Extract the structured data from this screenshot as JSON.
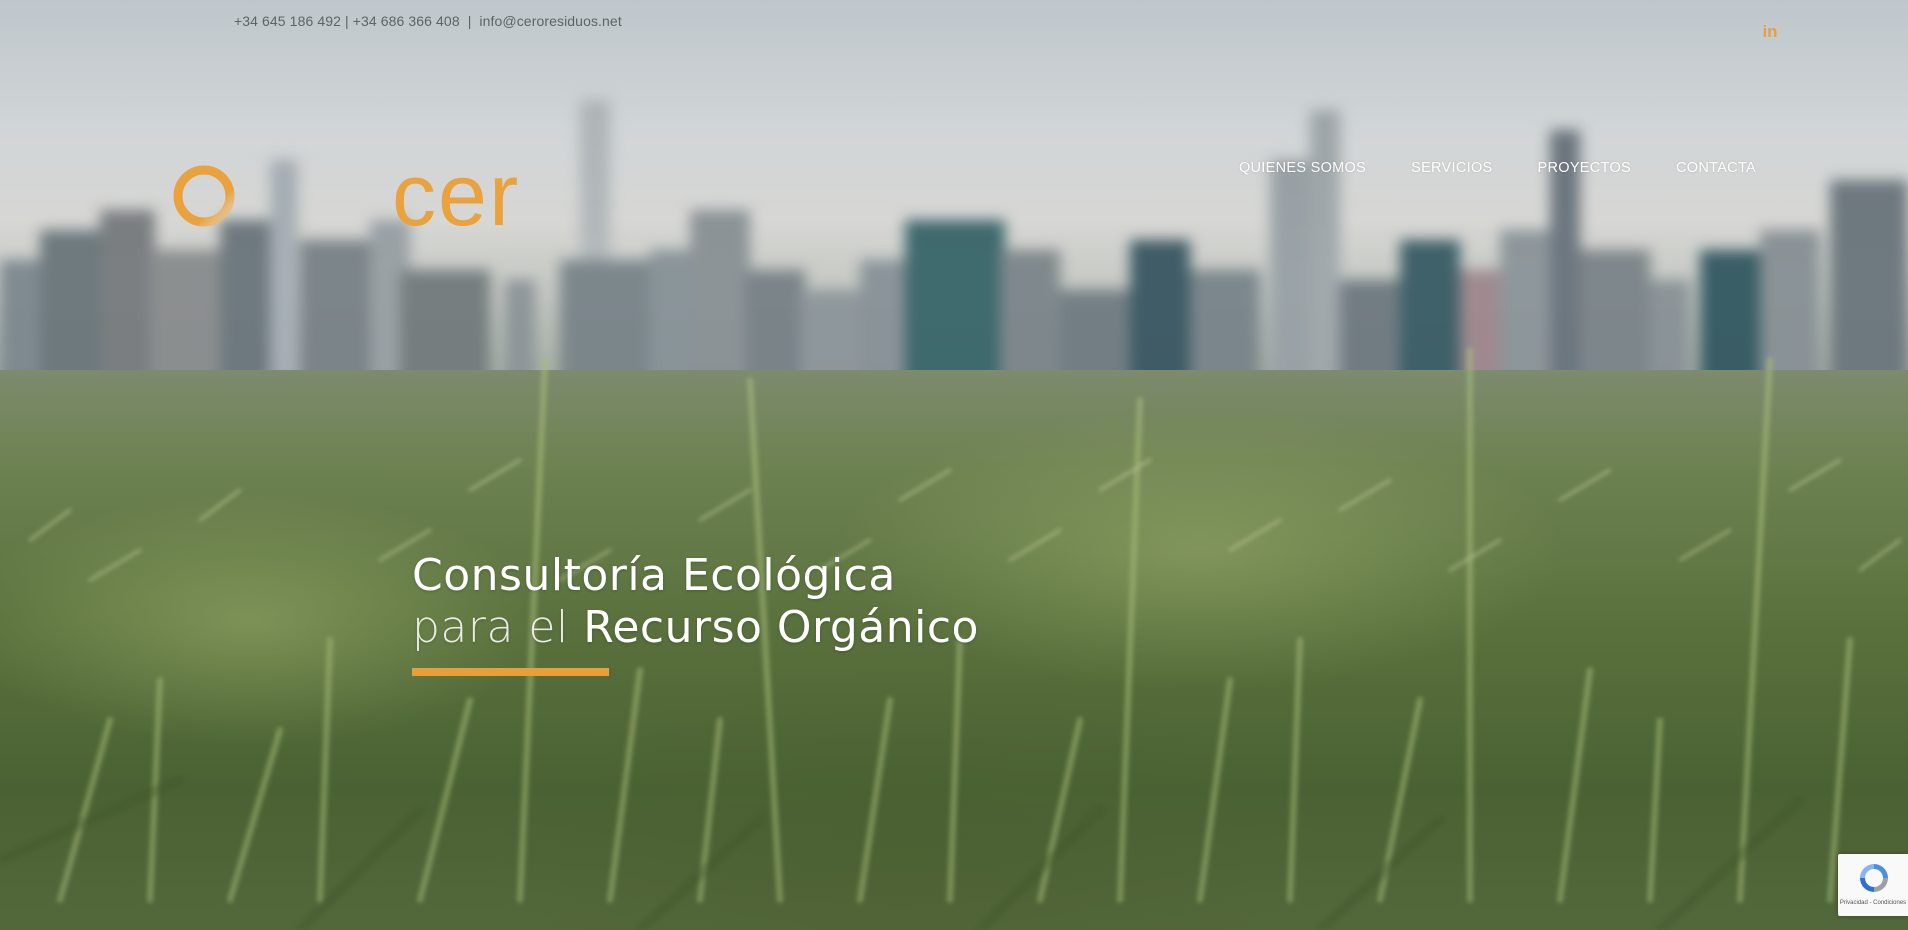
{
  "topbar": {
    "phones": "+34 645 186 492 | +34 686 366 408",
    "separator": "|",
    "email": "info@ceroresiduos.net",
    "social_icon": "linkedin-icon",
    "social_label": "in"
  },
  "logo": {
    "text": "cer",
    "accent_color": "#e9a23d"
  },
  "nav": {
    "items": [
      {
        "label": "QUIENES SOMOS"
      },
      {
        "label": "SERVICIOS"
      },
      {
        "label": "PROYECTOS"
      },
      {
        "label": "CONTACTA"
      }
    ]
  },
  "hero": {
    "line1": "Consultoría Ecológica",
    "line2_light": "para el",
    "line2_bold": "Recurso Orgánico",
    "bar_color": "#e89f3a"
  },
  "recaptcha": {
    "icon": "recaptcha-icon",
    "footer": "Privacidad - Condiciones"
  }
}
